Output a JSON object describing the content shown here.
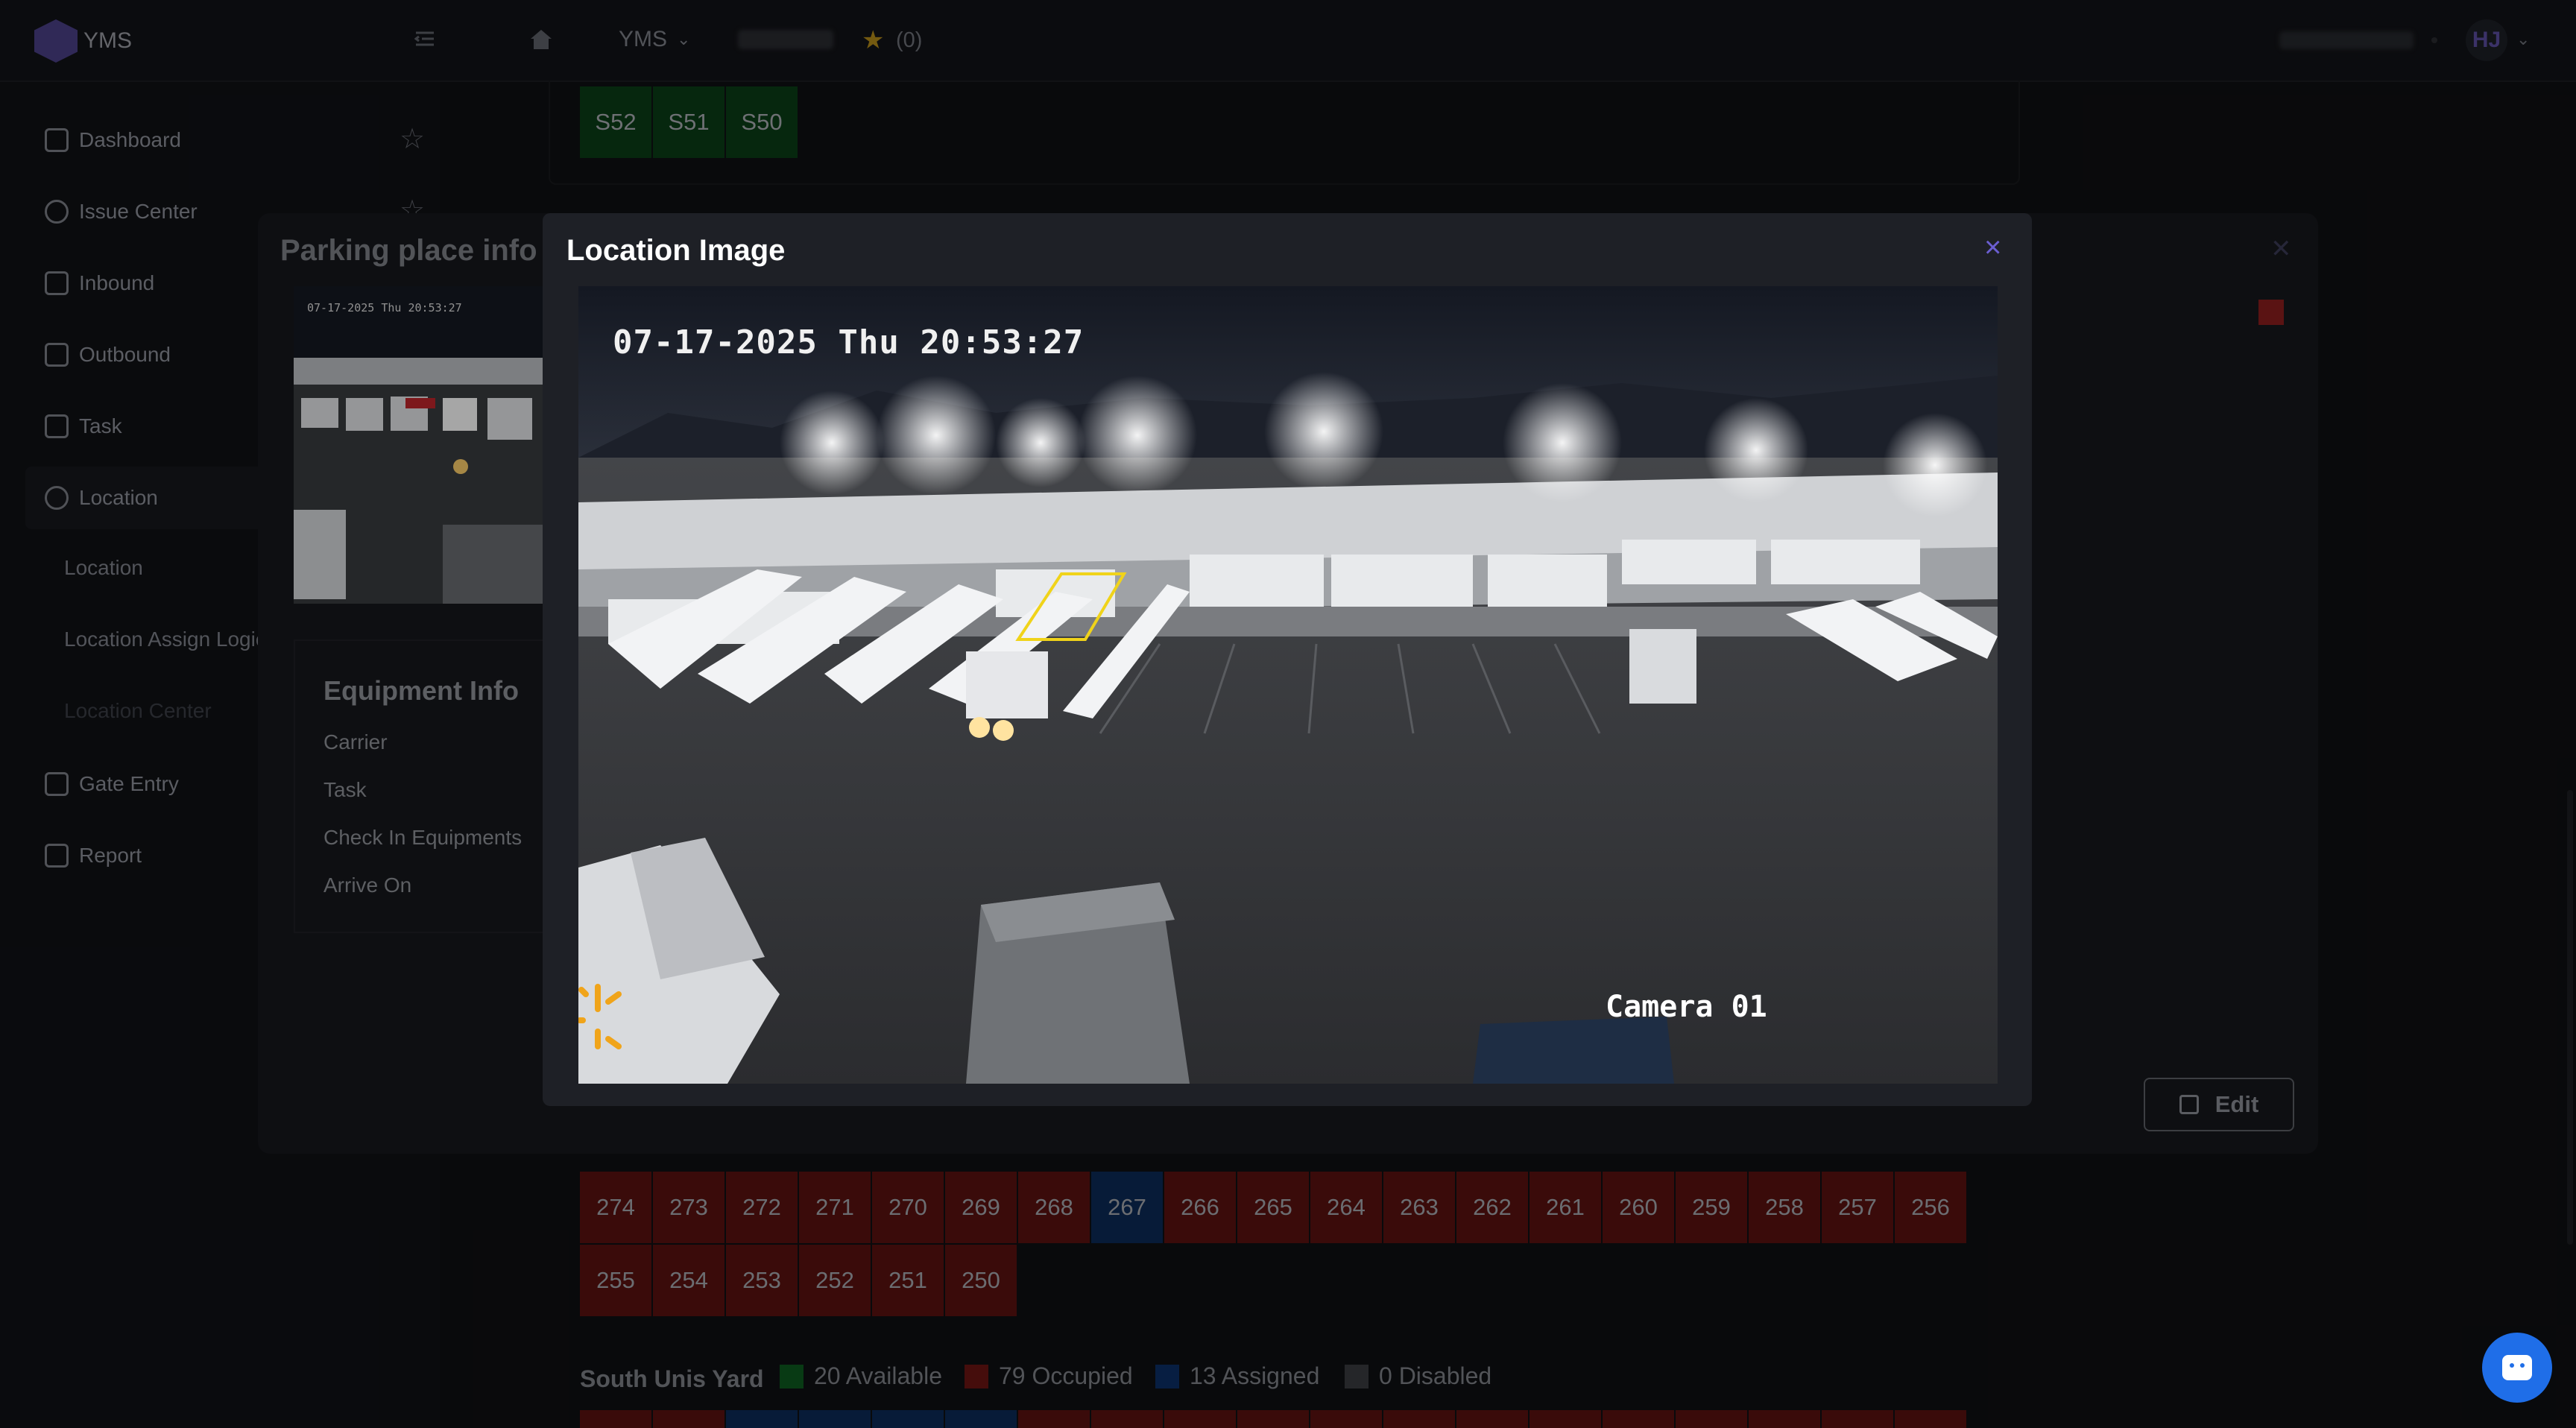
{
  "app": {
    "name": "YMS"
  },
  "header": {
    "breadcrumb": "YMS",
    "favorites_count": "(0)",
    "user_initials": "HJ"
  },
  "sidebar": {
    "items": [
      {
        "label": "Dashboard",
        "icon": "dashboard-icon"
      },
      {
        "label": "Issue Center",
        "icon": "help-circle-icon"
      },
      {
        "label": "Inbound",
        "icon": "inbound-icon"
      },
      {
        "label": "Outbound",
        "icon": "outbound-icon"
      },
      {
        "label": "Task",
        "icon": "task-icon"
      },
      {
        "label": "Location",
        "icon": "location-pin-icon"
      },
      {
        "label": "Gate Entry",
        "icon": "gate-entry-icon"
      },
      {
        "label": "Report",
        "icon": "report-icon"
      }
    ],
    "sub_items": [
      "Location",
      "Location Assign Logic",
      "Location Center"
    ]
  },
  "top_spots": [
    "S52",
    "S51",
    "S50"
  ],
  "parking_modal": {
    "title": "Parking place info",
    "equipment_title": "Equipment Info",
    "fields": [
      "Carrier",
      "Task",
      "Check In Equipments",
      "Arrive On"
    ],
    "edit_label": "Edit",
    "thumb_timestamp": "07-17-2025 Thu 20:53:27"
  },
  "location_modal": {
    "title": "Location Image",
    "close_label": "×",
    "timestamp": "07-17-2025 Thu 20:53:27",
    "camera_label": "Camera 01"
  },
  "spots_row1": [
    {
      "n": "274",
      "s": "r"
    },
    {
      "n": "273",
      "s": "r"
    },
    {
      "n": "272",
      "s": "r"
    },
    {
      "n": "271",
      "s": "r"
    },
    {
      "n": "270",
      "s": "r"
    },
    {
      "n": "269",
      "s": "r"
    },
    {
      "n": "268",
      "s": "r"
    },
    {
      "n": "267",
      "s": "b"
    },
    {
      "n": "266",
      "s": "r"
    },
    {
      "n": "265",
      "s": "r"
    },
    {
      "n": "264",
      "s": "r"
    },
    {
      "n": "263",
      "s": "r"
    },
    {
      "n": "262",
      "s": "r"
    },
    {
      "n": "261",
      "s": "r"
    },
    {
      "n": "260",
      "s": "r"
    },
    {
      "n": "259",
      "s": "r"
    },
    {
      "n": "258",
      "s": "r"
    },
    {
      "n": "257",
      "s": "r"
    },
    {
      "n": "256",
      "s": "r"
    }
  ],
  "spots_row2": [
    "255",
    "254",
    "253",
    "252",
    "251",
    "250"
  ],
  "yard": {
    "name": "South Unis Yard",
    "legend": [
      {
        "label": "20 Available",
        "color": "#0d5a1f"
      },
      {
        "label": "79 Occupied",
        "color": "#6b1513"
      },
      {
        "label": "13 Assigned",
        "color": "#0c2f66"
      },
      {
        "label": "0 Disabled",
        "color": "#3a3b40"
      }
    ]
  },
  "colors": {
    "accent": "#6b5ed1",
    "available": "#0a3d16",
    "occupied": "#5a1210",
    "assigned": "#0c2a56",
    "chat": "#1f6ee8"
  }
}
